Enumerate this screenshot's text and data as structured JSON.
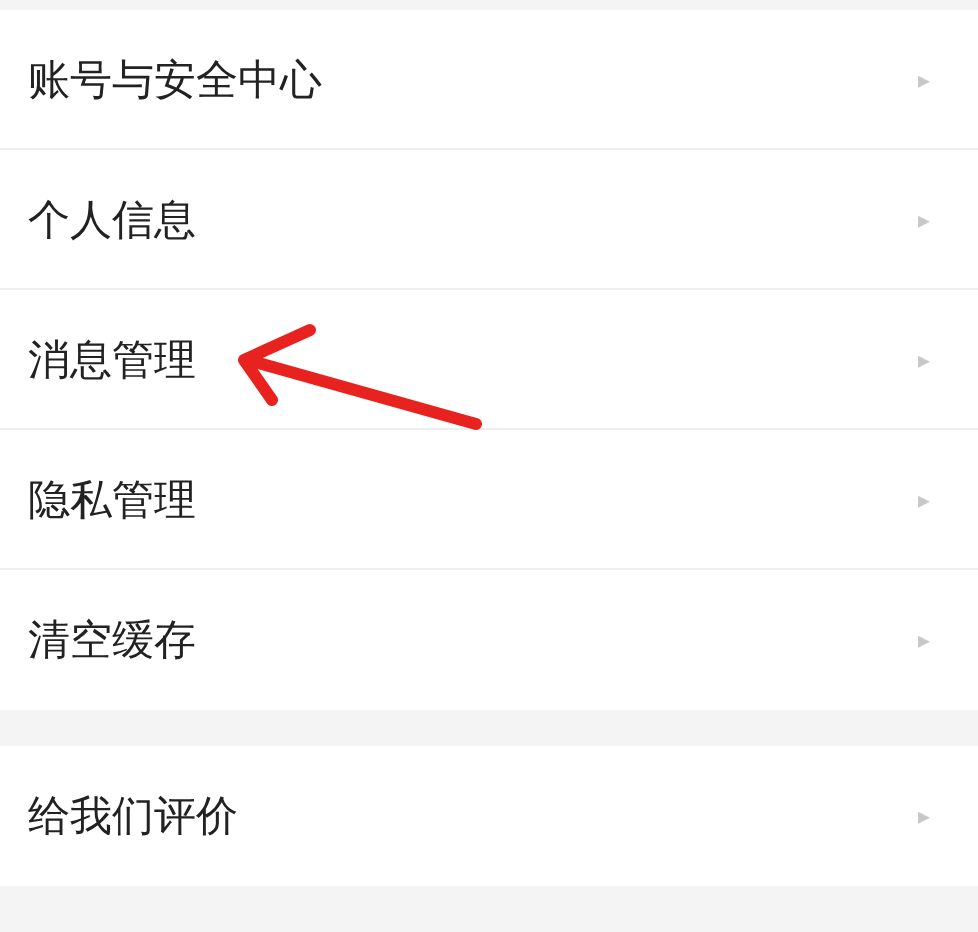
{
  "sections": [
    {
      "items": [
        {
          "label": "账号与安全中心",
          "chevron": "▸"
        },
        {
          "label": "个人信息",
          "chevron": "▸"
        },
        {
          "label": "消息管理",
          "chevron": "▸"
        },
        {
          "label": "隐私管理",
          "chevron": "▸"
        },
        {
          "label": "清空缓存",
          "chevron": "▸"
        }
      ]
    },
    {
      "items": [
        {
          "label": "给我们评价",
          "chevron": "▸"
        }
      ]
    }
  ]
}
